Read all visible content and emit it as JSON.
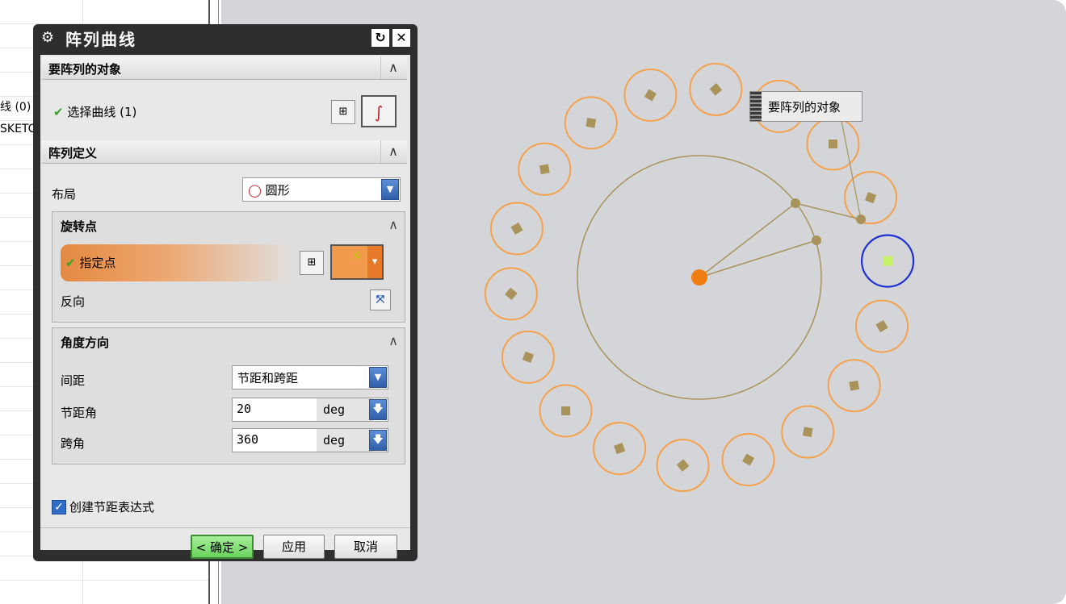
{
  "navigator": {
    "cell1": "线 (0)",
    "cell2": "SKETCH"
  },
  "canvas": {
    "tooltip": "要阵列的对象",
    "colors": {
      "array_ring": "#f5a04a",
      "array_marker": "#a9935a",
      "source_ring": "#1f2fd4",
      "source_marker": "#c7f26a",
      "construction": "#a9935a",
      "center_point": "#f07d10",
      "background": "#d4d5d9"
    }
  },
  "dialog": {
    "title": "阵列曲线",
    "reset_icon": "reset-icon",
    "close_icon": "close-icon",
    "objects_section": {
      "title": "要阵列的对象",
      "select_label": "选择曲线 (1)"
    },
    "definition_section": {
      "title": "阵列定义",
      "layout_label": "布局",
      "layout_value": "圆形",
      "pivot_group": {
        "title": "旋转点",
        "point_label": "指定点",
        "reverse_label": "反向"
      },
      "angle_group": {
        "title": "角度方向",
        "spacing_label": "间距",
        "spacing_value": "节距和跨距",
        "pitch_label": "节距角",
        "pitch_value": "20",
        "pitch_unit": "deg",
        "span_label": "跨角",
        "span_value": "360",
        "span_unit": "deg"
      },
      "create_expr_label": "创建节距表达式"
    },
    "buttons": {
      "ok": "< 确定 >",
      "apply": "应用",
      "cancel": "取消"
    }
  }
}
